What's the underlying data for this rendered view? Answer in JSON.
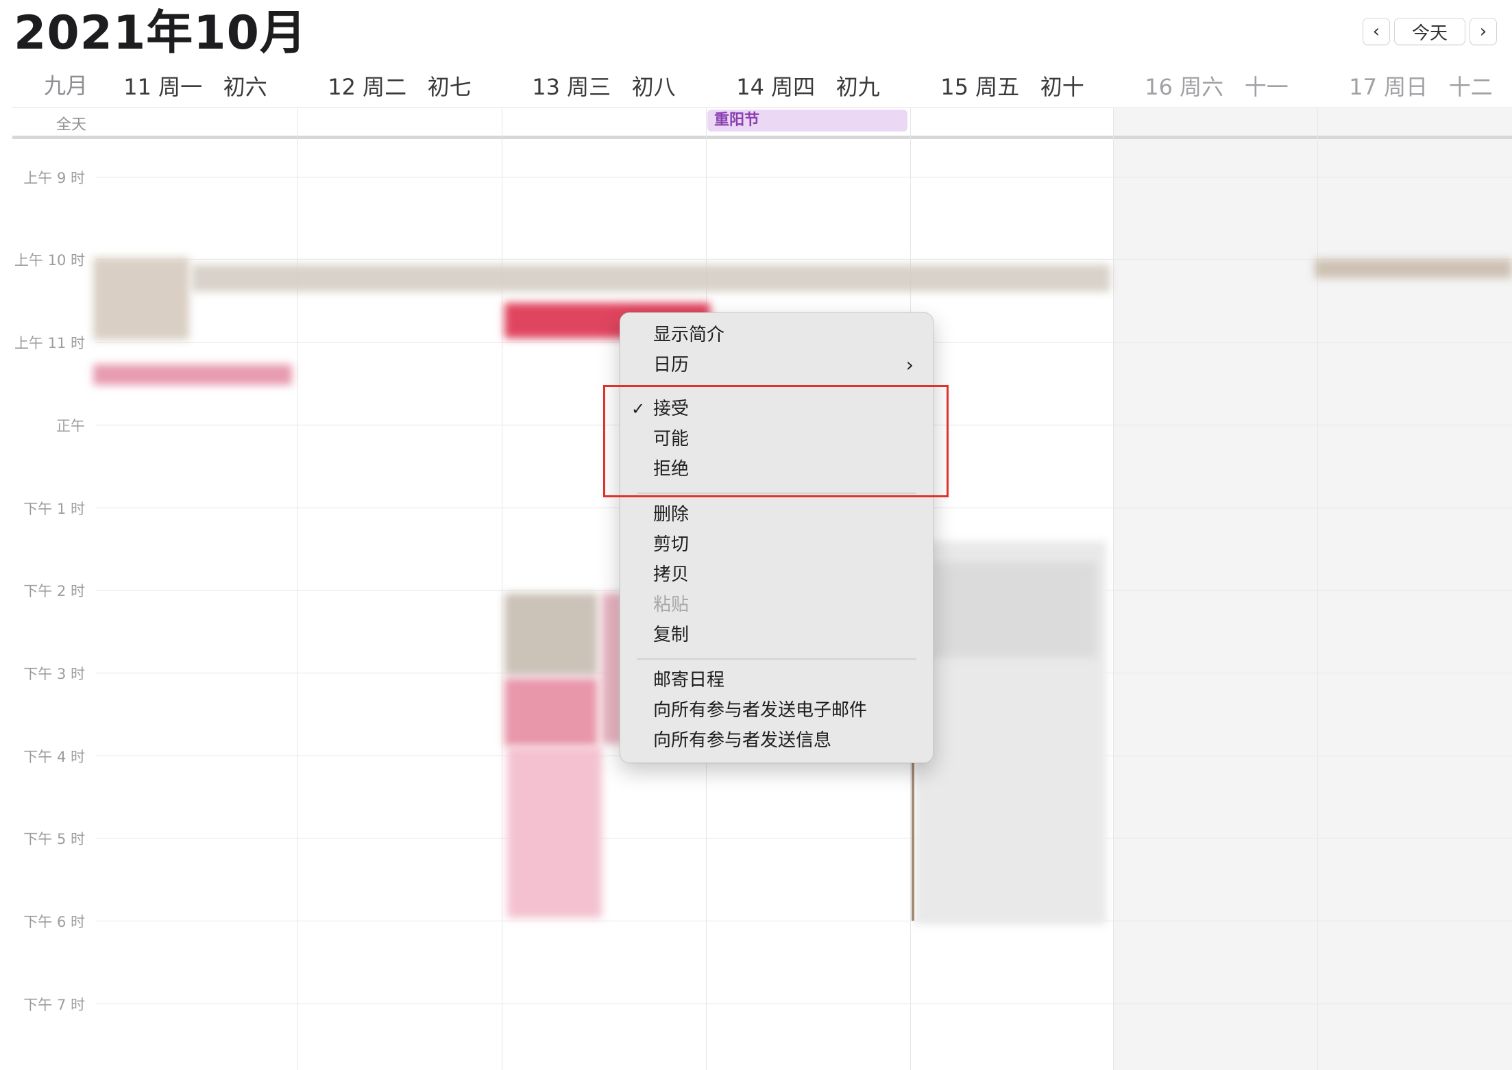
{
  "calendar": {
    "title": "2021年10月",
    "nav": {
      "prev_icon": "‹",
      "today_label": "今天",
      "next_icon": "›"
    },
    "month_label": "九月",
    "all_day_label": "全天",
    "days": [
      {
        "header": "11 周一   初六"
      },
      {
        "header": "12 周二   初七"
      },
      {
        "header": "13 周三   初八"
      },
      {
        "header": "14 周四   初九"
      },
      {
        "header": "15 周五   初十"
      },
      {
        "header": "16 周六   十一"
      },
      {
        "header": "17 周日   十二"
      }
    ],
    "all_day_event": {
      "title": "重阳节",
      "color": "#ead8f5",
      "text_color": "#8b3fb0"
    },
    "hours": [
      "上午 9 时",
      "上午 10 时",
      "上午 11 时",
      "正午",
      "下午 1 时",
      "下午 2 时",
      "下午 3 时",
      "下午 4 时",
      "下午 5 时",
      "下午 6 时",
      "下午 7 时"
    ]
  },
  "context_menu": {
    "items": {
      "show_info": "显示简介",
      "calendar": "日历",
      "accept": "接受",
      "maybe": "可能",
      "decline": "拒绝",
      "delete": "删除",
      "cut": "剪切",
      "copy": "拷贝",
      "paste": "粘贴",
      "duplicate": "复制",
      "mail_event": "邮寄日程",
      "email_all": "向所有参与者发送电子邮件",
      "message_all": "向所有参与者发送信息"
    },
    "checkmark": "✓",
    "submenu_arrow": "›"
  },
  "colors": {
    "highlight": "#e0322a",
    "event_red": "#e0455f",
    "event_pink": "#f3c1cf"
  }
}
